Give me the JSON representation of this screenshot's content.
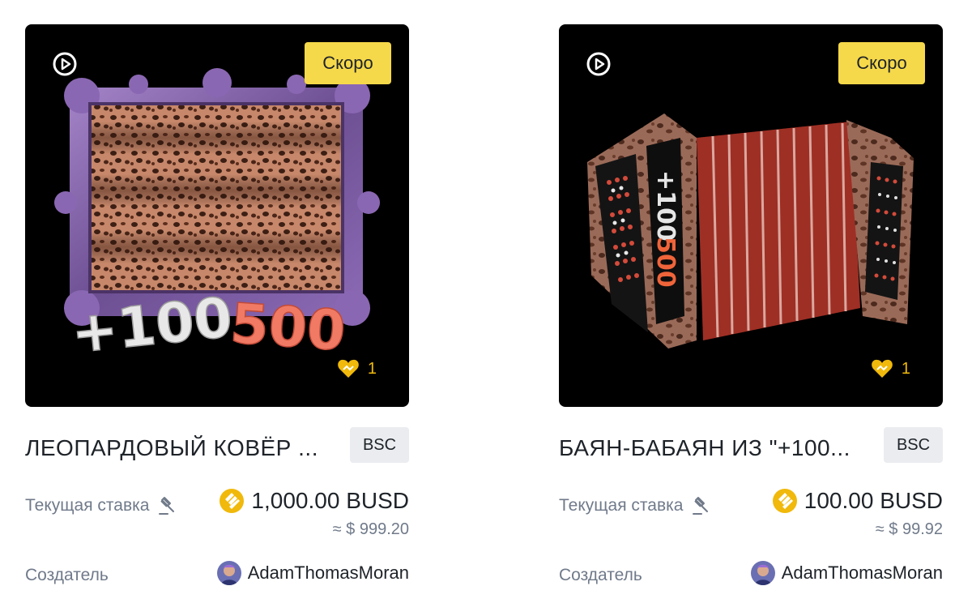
{
  "cards": [
    {
      "badge": "Скоро",
      "likes": "1",
      "title": "ЛЕОПАРДОВЫЙ КОВЁР ...",
      "chain": "BSC",
      "bid_label": "Текущая ставка",
      "bid_amount": "1,000.00 BUSD",
      "usd_approx": "≈ $ 999.20",
      "creator_label": "Создатель",
      "creator_name": "AdamThomasMoran",
      "art_text": "+100500"
    },
    {
      "badge": "Скоро",
      "likes": "1",
      "title": "БАЯН-БАБАЯН ИЗ \"+100...",
      "chain": "BSC",
      "bid_label": "Текущая ставка",
      "bid_amount": "100.00 BUSD",
      "usd_approx": "≈ $ 99.92",
      "creator_label": "Создатель",
      "creator_name": "AdamThomasMoran",
      "art_text": "+100500"
    }
  ],
  "icons": {
    "play": "play-circle-icon",
    "like": "heart-icon",
    "auction": "auction-hammer-icon",
    "currency": "busd-coin-icon"
  },
  "colors": {
    "badge_yellow": "#f6d94a",
    "coin_gold": "#f0b90b",
    "text_primary": "#1e2329",
    "text_secondary": "#707a8a",
    "chip_bg": "#eaecef"
  }
}
